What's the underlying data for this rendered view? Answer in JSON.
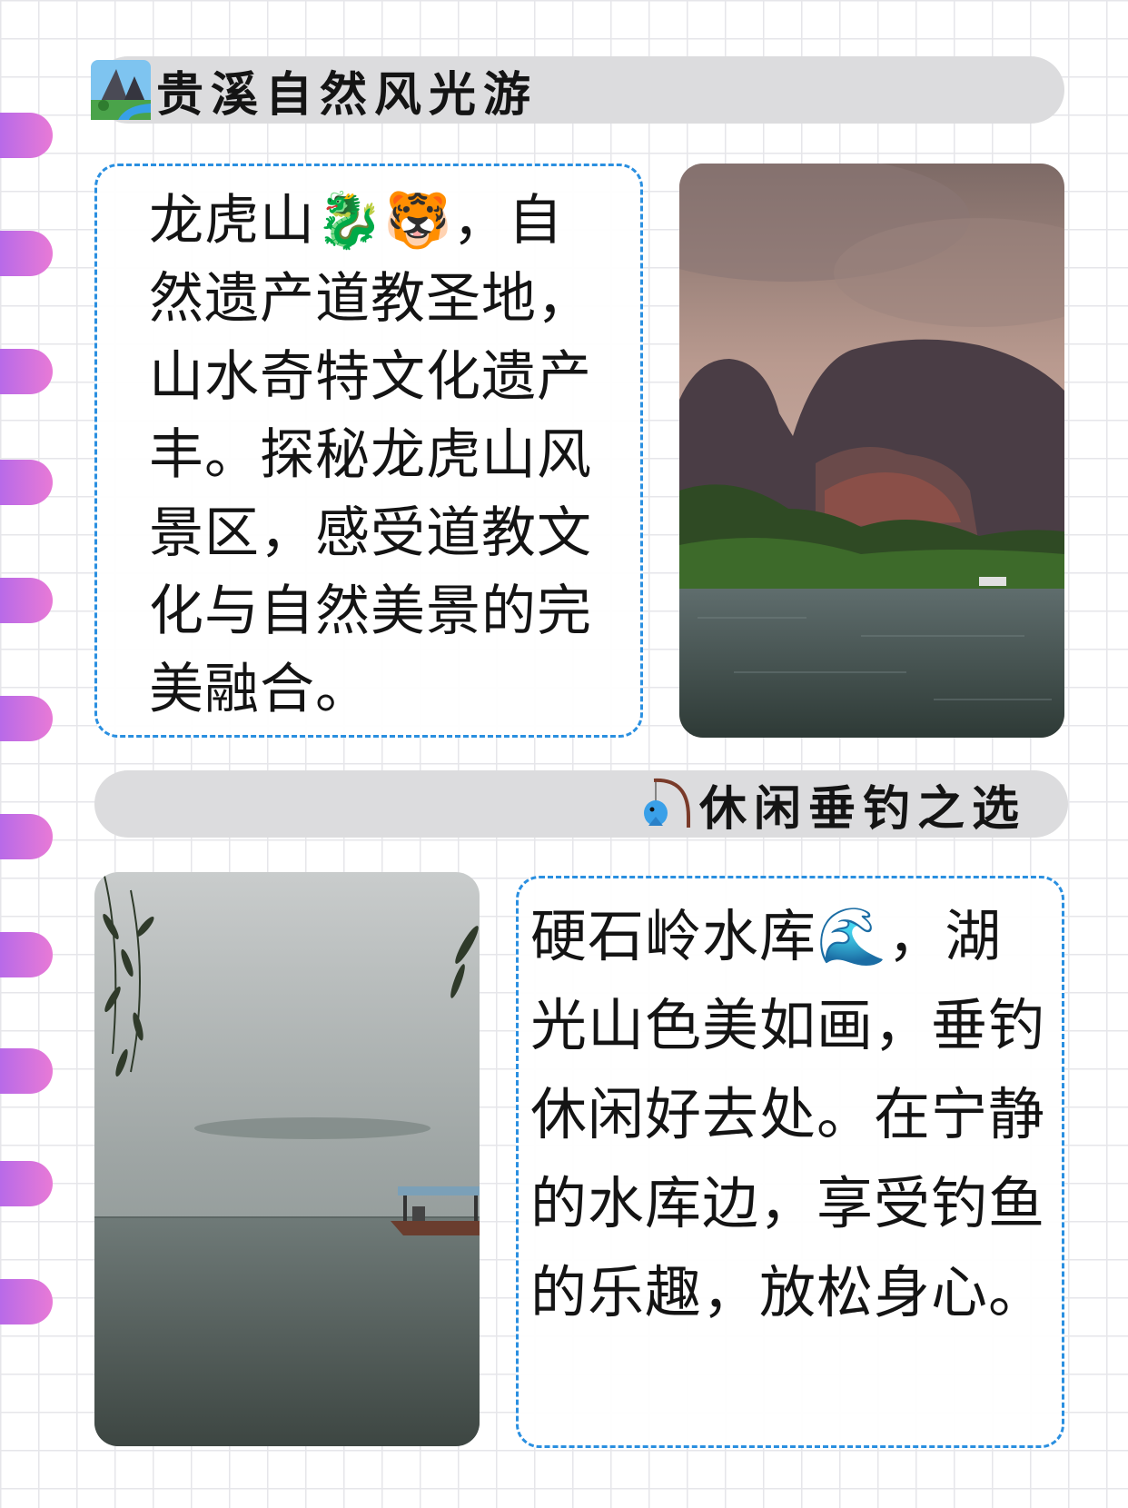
{
  "section1": {
    "title": "贵溪自然风光游",
    "title_icon": "mountain-lake-icon",
    "body": "龙虎山🐉🐯，自然遗产道教圣地，山水奇特文化遗产丰。探秘龙虎山风景区，感受道教文化与自然美景的完美融合。",
    "photo": "longhu-mountain-lake-photo"
  },
  "section2": {
    "title": "休闲垂钓之选",
    "title_icon": "fishing-icon",
    "body": "硬石岭水库🌊，湖光山色美如画，垂钓休闲好去处。在宁静的水库边，享受钓鱼的乐趣，放松身心。",
    "photo": "reservoir-boat-photo"
  },
  "colors": {
    "accent_border": "#2a8fe0",
    "banner_bg": "#dcdcde",
    "tab_gradient": [
      "#b86ae8",
      "#e87ad6"
    ]
  }
}
